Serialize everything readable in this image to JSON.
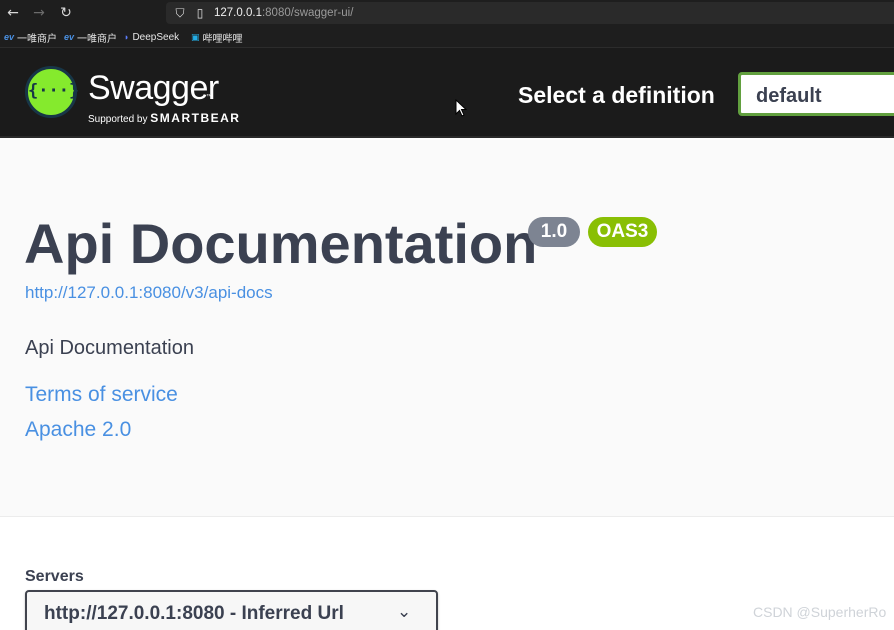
{
  "browser": {
    "url_host": "127.0.0.1",
    "url_path": ":8080/swagger-ui/",
    "bookmarks": [
      "一唯商户",
      "一唯商户",
      "DeepSeek",
      "哔哩哔哩"
    ]
  },
  "topbar": {
    "brand": "Swagger",
    "supported_by": "Supported by",
    "smartbear": "SMARTBEAR",
    "select_label": "Select a definition",
    "definition_value": "default"
  },
  "info": {
    "title": "Api Documentation",
    "version_badge": "1.0",
    "oas_badge": "OAS3",
    "docs_url": "http://127.0.0.1:8080/v3/api-docs",
    "description": "Api Documentation",
    "terms_link": "Terms of service",
    "license_link": "Apache 2.0"
  },
  "servers": {
    "label": "Servers",
    "selected": "http://127.0.0.1:8080 - Inferred Url"
  },
  "watermark": "CSDN @SuperherRo",
  "colors": {
    "swagger_green": "#85ea2d",
    "select_border": "#62a03f",
    "oas_badge": "#89bf04",
    "version_badge": "#7d8492",
    "link": "#4990e2",
    "text": "#3b4151"
  }
}
